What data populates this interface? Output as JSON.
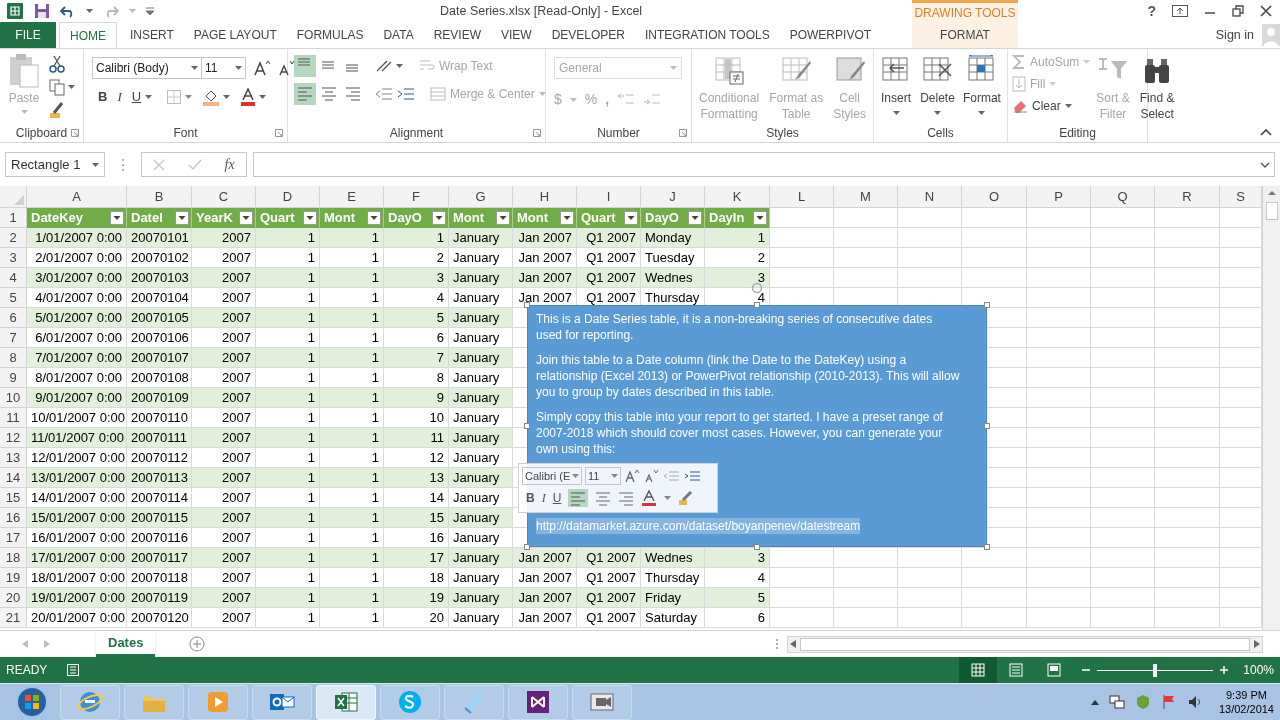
{
  "window": {
    "title": "Date Series.xlsx  [Read-Only] - Excel",
    "help": "?"
  },
  "ribbon_tabs": [
    {
      "label": "FILE",
      "kind": "file",
      "selected": false
    },
    {
      "label": "HOME",
      "kind": "tab",
      "selected": true
    },
    {
      "label": "INSERT",
      "kind": "tab",
      "selected": false
    },
    {
      "label": "PAGE LAYOUT",
      "kind": "tab",
      "selected": false
    },
    {
      "label": "FORMULAS",
      "kind": "tab",
      "selected": false
    },
    {
      "label": "DATA",
      "kind": "tab",
      "selected": false
    },
    {
      "label": "REVIEW",
      "kind": "tab",
      "selected": false
    },
    {
      "label": "VIEW",
      "kind": "tab",
      "selected": false
    },
    {
      "label": "DEVELOPER",
      "kind": "tab",
      "selected": false
    },
    {
      "label": "INTEGRATION TOOLS",
      "kind": "tab",
      "selected": false
    },
    {
      "label": "POWERPIVOT",
      "kind": "tab",
      "selected": false
    }
  ],
  "context_tabs": {
    "group": "DRAWING TOOLS",
    "tabs": [
      {
        "label": "FORMAT",
        "selected": false
      }
    ]
  },
  "account": {
    "label": "Sign in"
  },
  "ribbon_groups": [
    {
      "kind": "clipboard",
      "label": "Clipboard",
      "paste": {
        "label": "Paste",
        "disabled": true
      }
    },
    {
      "kind": "font",
      "label": "Font",
      "font_name": "Calibri (Body)",
      "font_size": "11",
      "bold": "B",
      "italic": "I",
      "underline": "U"
    },
    {
      "kind": "alignment",
      "label": "Alignment",
      "vertical_align_buttons": [
        {
          "selected": true
        },
        {
          "selected": false
        },
        {
          "selected": false
        }
      ],
      "horizontal_align_buttons": [
        {
          "selected": true
        },
        {
          "selected": false
        },
        {
          "selected": false
        }
      ],
      "buttons": [
        {
          "label": "Wrap Text",
          "disabled": true
        },
        {
          "label": "Merge & Center",
          "disabled": true
        }
      ]
    },
    {
      "kind": "number",
      "label": "Number",
      "format": "General",
      "currency": "$",
      "percent": "%",
      "comma": ",",
      "disabled": true
    },
    {
      "kind": "large_buttons",
      "label": "Styles",
      "buttons": [
        {
          "label_lines": [
            "Conditional",
            "Formatting"
          ],
          "disabled": true
        },
        {
          "label_lines": [
            "Format as",
            "Table"
          ],
          "disabled": true
        },
        {
          "label_lines": [
            "Cell",
            "Styles"
          ],
          "disabled": true
        }
      ]
    },
    {
      "kind": "large_buttons",
      "label": "Cells",
      "buttons": [
        {
          "label_lines": [
            "Insert"
          ],
          "disabled": false
        },
        {
          "label_lines": [
            "Delete"
          ],
          "disabled": false
        },
        {
          "label_lines": [
            "Format"
          ],
          "disabled": false
        }
      ]
    },
    {
      "kind": "editing",
      "label": "Editing",
      "small_buttons": [
        {
          "label": "AutoSum",
          "disabled": true
        },
        {
          "label": "Fill",
          "disabled": true
        },
        {
          "label": "Clear",
          "disabled": false
        }
      ],
      "large_buttons": [
        {
          "label_lines": [
            "Sort &",
            "Filter"
          ],
          "disabled": true
        },
        {
          "label_lines": [
            "Find &",
            "Select"
          ],
          "disabled": false
        }
      ]
    }
  ],
  "formula_bar": {
    "name_box": "Rectangle 1",
    "function_label": "fx"
  },
  "sheet": {
    "columns": [
      "A",
      "B",
      "C",
      "D",
      "E",
      "F",
      "G",
      "H",
      "I",
      "J",
      "K",
      "L",
      "M",
      "N",
      "O",
      "P",
      "Q",
      "R",
      "S"
    ],
    "header_row": {
      "number": "1",
      "cells": [
        "DateKey",
        "DateI",
        "YearK",
        "Quart",
        "Mont",
        "DayO",
        "Mont",
        "Mont",
        "Quart",
        "DayO",
        "DayIn"
      ]
    },
    "rows": [
      {
        "number": "2",
        "cells": [
          "1/01/2007 0:00",
          "20070101",
          "2007",
          "1",
          "1",
          "1",
          "January",
          "Jan 2007",
          "Q1 2007",
          "Monday",
          "1"
        ]
      },
      {
        "number": "3",
        "cells": [
          "2/01/2007 0:00",
          "20070102",
          "2007",
          "1",
          "1",
          "2",
          "January",
          "Jan 2007",
          "Q1 2007",
          "Tuesday",
          "2"
        ]
      },
      {
        "number": "4",
        "cells": [
          "3/01/2007 0:00",
          "20070103",
          "2007",
          "1",
          "1",
          "3",
          "January",
          "Jan 2007",
          "Q1 2007",
          "Wednes",
          "3"
        ]
      },
      {
        "number": "5",
        "cells": [
          "4/01/2007 0:00",
          "20070104",
          "2007",
          "1",
          "1",
          "4",
          "January",
          "Jan 2007",
          "Q1 2007",
          "Thursday",
          "4"
        ]
      },
      {
        "number": "6",
        "cells": [
          "5/01/2007 0:00",
          "20070105",
          "2007",
          "1",
          "1",
          "5",
          "January"
        ]
      },
      {
        "number": "7",
        "cells": [
          "6/01/2007 0:00",
          "20070106",
          "2007",
          "1",
          "1",
          "6",
          "January"
        ]
      },
      {
        "number": "8",
        "cells": [
          "7/01/2007 0:00",
          "20070107",
          "2007",
          "1",
          "1",
          "7",
          "January"
        ]
      },
      {
        "number": "9",
        "cells": [
          "8/01/2007 0:00",
          "20070108",
          "2007",
          "1",
          "1",
          "8",
          "January"
        ]
      },
      {
        "number": "10",
        "cells": [
          "9/01/2007 0:00",
          "20070109",
          "2007",
          "1",
          "1",
          "9",
          "January"
        ]
      },
      {
        "number": "11",
        "cells": [
          "10/01/2007 0:00",
          "20070110",
          "2007",
          "1",
          "1",
          "10",
          "January"
        ]
      },
      {
        "number": "12",
        "cells": [
          "11/01/2007 0:00",
          "20070111",
          "2007",
          "1",
          "1",
          "11",
          "January"
        ]
      },
      {
        "number": "13",
        "cells": [
          "12/01/2007 0:00",
          "20070112",
          "2007",
          "1",
          "1",
          "12",
          "January"
        ]
      },
      {
        "number": "14",
        "cells": [
          "13/01/2007 0:00",
          "20070113",
          "2007",
          "1",
          "1",
          "13",
          "January"
        ]
      },
      {
        "number": "15",
        "cells": [
          "14/01/2007 0:00",
          "20070114",
          "2007",
          "1",
          "1",
          "14",
          "January"
        ]
      },
      {
        "number": "16",
        "cells": [
          "15/01/2007 0:00",
          "20070115",
          "2007",
          "1",
          "1",
          "15",
          "January"
        ]
      },
      {
        "number": "17",
        "cells": [
          "16/01/2007 0:00",
          "20070116",
          "2007",
          "1",
          "1",
          "16",
          "January"
        ]
      },
      {
        "number": "18",
        "cells": [
          "17/01/2007 0:00",
          "20070117",
          "2007",
          "1",
          "1",
          "17",
          "January",
          "Jan 2007",
          "Q1 2007",
          "Wednes",
          "3"
        ]
      },
      {
        "number": "19",
        "cells": [
          "18/01/2007 0:00",
          "20070118",
          "2007",
          "1",
          "1",
          "18",
          "January",
          "Jan 2007",
          "Q1 2007",
          "Thursday",
          "4"
        ]
      },
      {
        "number": "20",
        "cells": [
          "19/01/2007 0:00",
          "20070119",
          "2007",
          "1",
          "1",
          "19",
          "January",
          "Jan 2007",
          "Q1 2007",
          "Friday",
          "5"
        ]
      },
      {
        "number": "21",
        "cells": [
          "20/01/2007 0:00",
          "20070120",
          "2007",
          "1",
          "1",
          "20",
          "January",
          "Jan 2007",
          "Q1 2007",
          "Saturday",
          "6"
        ]
      }
    ]
  },
  "text_box": {
    "paragraphs": [
      "This is a Date Series table, it is a non-breaking series of consecutive dates used for reporting.",
      "Join this table to a Date column (link the Date to the DateKey)  using a relationship (Excel 2013) or PowerPivot relationship (2010-2013). This will allow you to group by dates described in this table.",
      "Simply copy this table into your report to get started. I have a preset range of 2007-2018 which should cover most cases. However, you can generate your own using this:"
    ],
    "link": "http://datamarket.azure.com/dataset/boyanpenev/datestream"
  },
  "mini_toolbar": {
    "font_name": "Calibri (E",
    "font_size": "11",
    "bold": "B",
    "italic": "I",
    "underline": "U"
  },
  "sheet_tabs": [
    {
      "label": "Dates",
      "selected": true
    }
  ],
  "status_bar": {
    "mode": "READY",
    "views": [
      {
        "kind": "normal",
        "selected": true
      },
      {
        "kind": "page_layout",
        "selected": false
      },
      {
        "kind": "page_break",
        "selected": false
      }
    ],
    "zoom_slider": {
      "level": 0.5
    },
    "zoom": "100%"
  },
  "taskbar": {
    "apps": [
      {
        "kind": "browser",
        "selected": false
      },
      {
        "kind": "folder",
        "selected": false
      },
      {
        "kind": "media",
        "selected": false
      },
      {
        "kind": "mail",
        "selected": false
      },
      {
        "kind": "spreadsheet",
        "selected": true
      },
      {
        "kind": "chat",
        "selected": false
      },
      {
        "kind": "notes",
        "selected": false
      },
      {
        "kind": "studio",
        "selected": false
      },
      {
        "kind": "video",
        "selected": false
      }
    ],
    "time": "9:39 PM",
    "date": "13/02/2014"
  }
}
